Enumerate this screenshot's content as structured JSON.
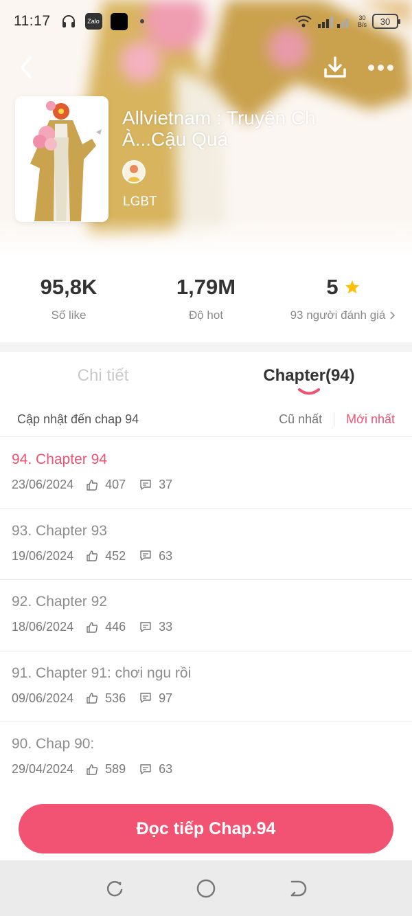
{
  "status_bar": {
    "time": "11:17",
    "zalo_label": "Zalo",
    "net_speed_value": "30",
    "net_speed_unit": "B/s",
    "battery": "30"
  },
  "book": {
    "title_line1": "Allvietnam : Truyện Ch",
    "title_line2": "À...Cậu Quá",
    "genre": "LGBT"
  },
  "stats": {
    "likes_value": "95,8K",
    "likes_label": "Số like",
    "hot_value": "1,79M",
    "hot_label": "Độ hot",
    "rating_value": "5",
    "rating_label": "93 người đánh giá"
  },
  "tabs": {
    "details": "Chi tiết",
    "chapters": "Chapter(94)"
  },
  "sort": {
    "update_text": "Cập nhật đến chap 94",
    "oldest": "Cũ nhất",
    "newest": "Mới nhất"
  },
  "chapters": [
    {
      "title": "94. Chapter 94",
      "date": "23/06/2024",
      "likes": "407",
      "comments": "37"
    },
    {
      "title": "93. Chapter 93",
      "date": "19/06/2024",
      "likes": "452",
      "comments": "63"
    },
    {
      "title": "92. Chapter 92",
      "date": "18/06/2024",
      "likes": "446",
      "comments": "33"
    },
    {
      "title": "91. Chapter 91: chơi ngu rồi",
      "date": "09/06/2024",
      "likes": "536",
      "comments": "97"
    },
    {
      "title": "90. Chap 90:",
      "date": "29/04/2024",
      "likes": "589",
      "comments": "63"
    }
  ],
  "cta": {
    "label": "Đọc tiếp Chap.94"
  },
  "colors": {
    "accent": "#f25372",
    "accent_text": "#ef5372",
    "star": "#ffc107",
    "cover_robe": "#c9a34e"
  },
  "icons": {
    "back": "chevron-left-icon",
    "download": "download-icon",
    "more": "more-dots-icon",
    "like": "thumb-up-icon",
    "comment": "comment-icon",
    "star": "star-icon",
    "nav_recent": "recent-apps-icon",
    "nav_home": "home-circle-icon",
    "nav_back": "back-nav-icon"
  }
}
